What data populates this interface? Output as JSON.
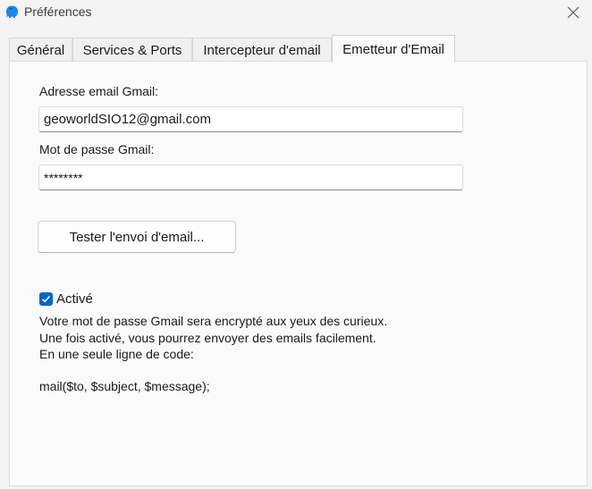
{
  "window": {
    "title": "Préférences",
    "close_icon": "close-icon",
    "app_icon": "elephant-icon"
  },
  "tabs": [
    {
      "label": "Général",
      "active": false
    },
    {
      "label": "Services & Ports",
      "active": false
    },
    {
      "label": "Intercepteur d'email",
      "active": false
    },
    {
      "label": "Emetteur d'Email",
      "active": true
    }
  ],
  "form": {
    "email_label": "Adresse email Gmail:",
    "email_value": "geoworldSIO12@gmail.com",
    "password_label": "Mot de passe Gmail:",
    "password_value": "********",
    "test_button_label": "Tester l'envoi d'email...",
    "enabled_label": "Activé",
    "enabled_checked": true
  },
  "description": {
    "lines": [
      "Votre mot de passe Gmail sera encrypté aux yeux des curieux.",
      "Une fois activé, vous pourrez envoyer des emails facilement.",
      "En une seule ligne de code:"
    ],
    "code": "mail($to, $subject, $message);"
  },
  "colors": {
    "accent": "#0067c0",
    "app_icon": "#1e88e5"
  }
}
